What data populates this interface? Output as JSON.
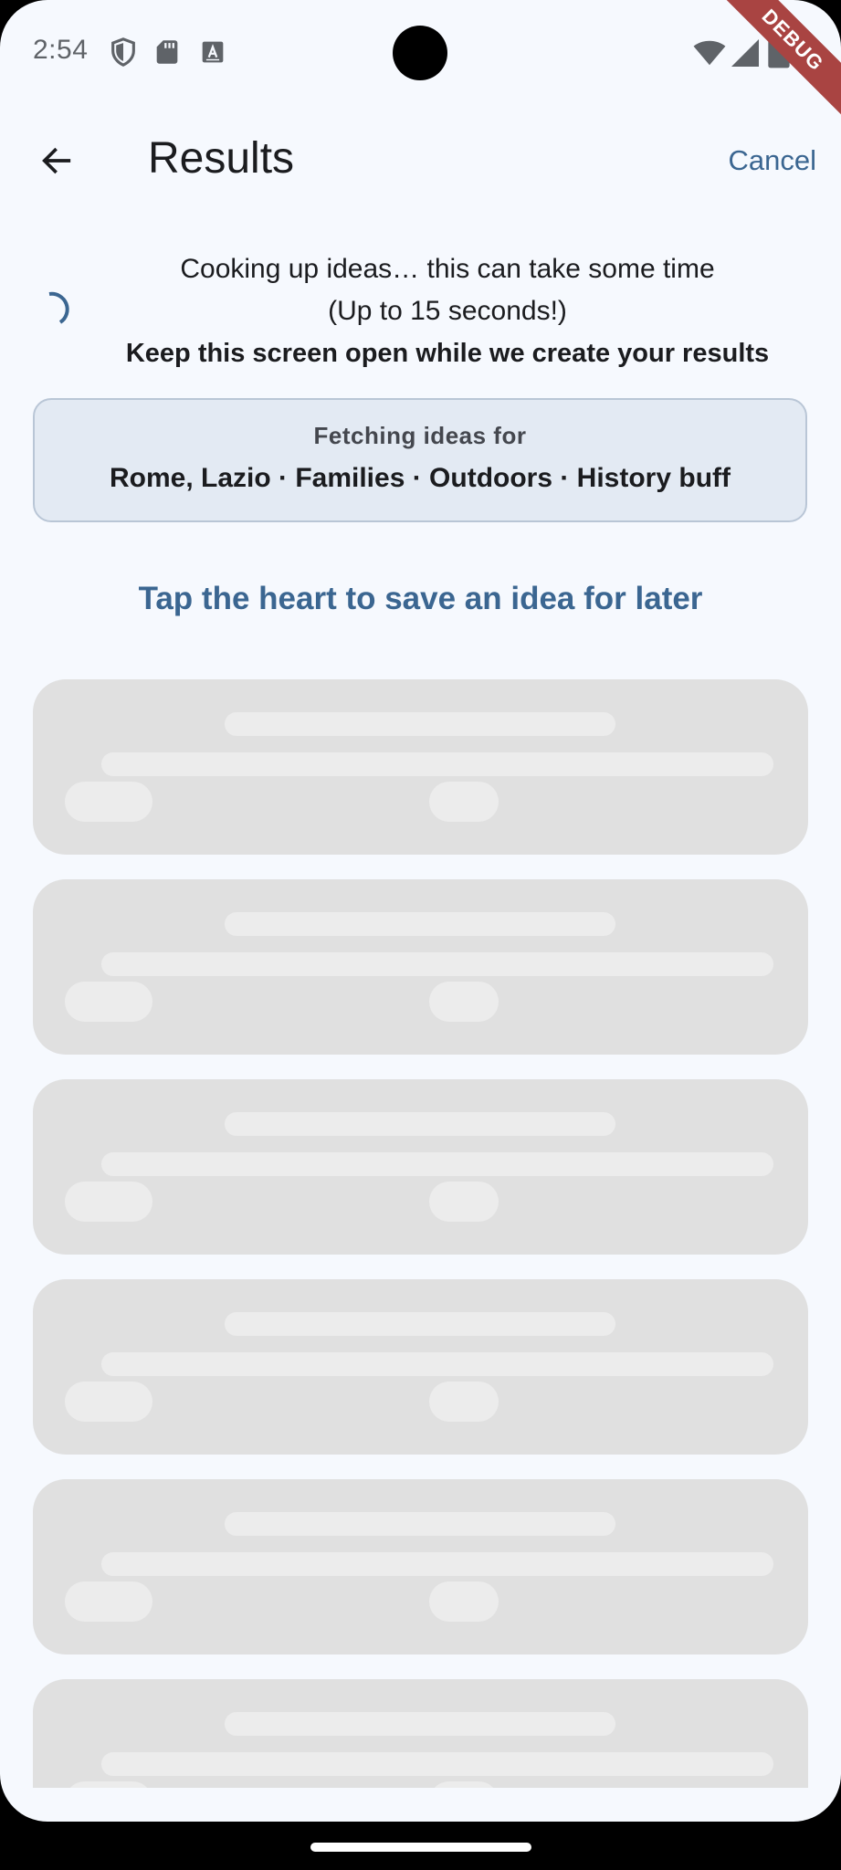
{
  "status_bar": {
    "time": "2:54",
    "icons": [
      "shield-icon",
      "sd-card-icon",
      "keyboard-a-icon",
      "wifi-icon",
      "signal-icon",
      "battery-icon"
    ],
    "debug_banner": "DEBUG"
  },
  "app_bar": {
    "back_icon": "arrow-left-icon",
    "title": "Results",
    "cancel_label": "Cancel"
  },
  "loading": {
    "line1": "Cooking up ideas… this can take some time",
    "line2": "(Up to 15 seconds!)",
    "line3": "Keep this screen open while we create your results"
  },
  "fetch_card": {
    "label": "Fetching ideas for",
    "summary": "Rome, Lazio · Families · Outdoors · History buff"
  },
  "hint": "Tap the heart to save an idea for later",
  "skeleton_card_count": 6,
  "colors": {
    "accent": "#3b6691",
    "background": "#f6f9fe",
    "card_bg": "#e3eaf3",
    "skeleton": "#e0e0e0",
    "debug_ribbon": "#a94442"
  }
}
